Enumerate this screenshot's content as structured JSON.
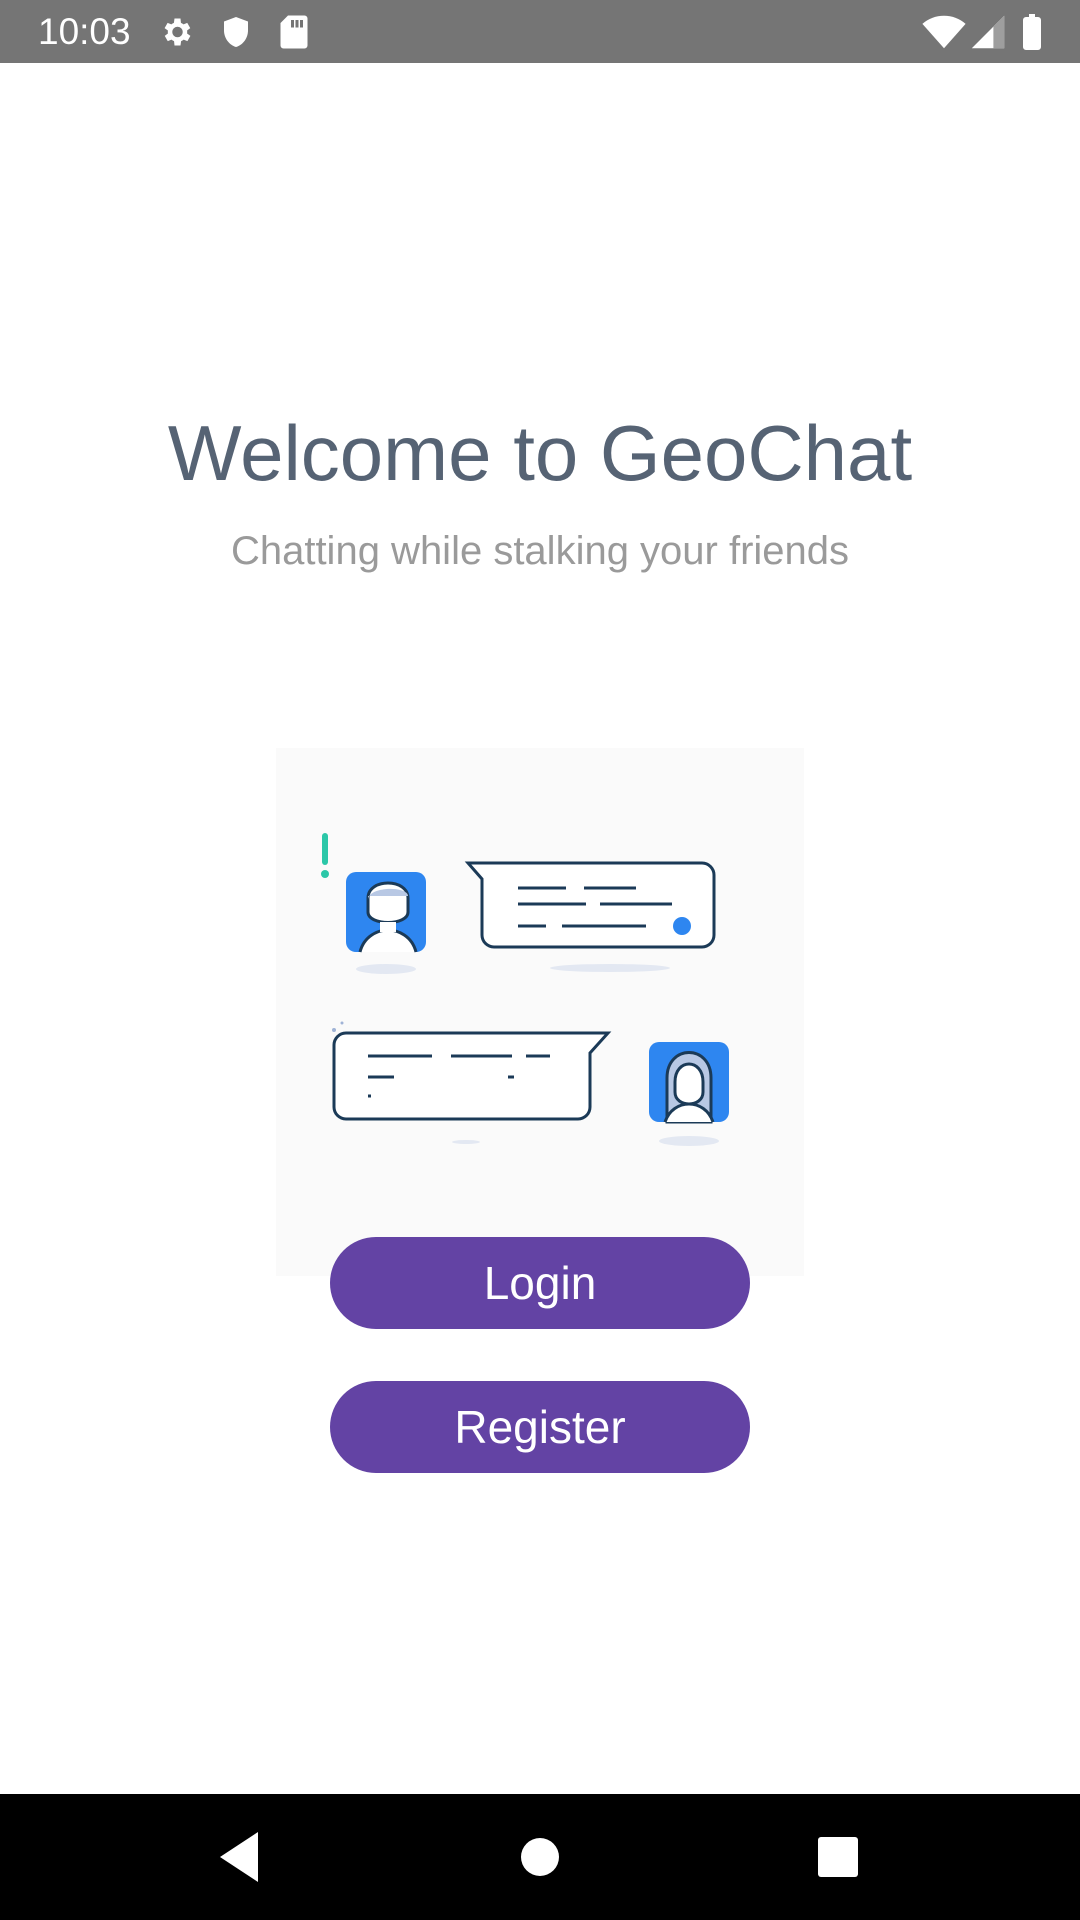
{
  "status_bar": {
    "time": "10:03",
    "icons_left": [
      "settings-icon",
      "shield-icon",
      "sd-card-icon"
    ],
    "icons_right": [
      "wifi-icon",
      "cellular-signal-icon",
      "battery-icon"
    ]
  },
  "welcome": {
    "title": "Welcome to GeoChat",
    "subtitle": "Chatting while stalking your friends"
  },
  "buttons": {
    "login_label": "Login",
    "register_label": "Register"
  },
  "nav_bar": {
    "items": [
      "back-icon",
      "home-icon",
      "recents-icon"
    ]
  },
  "colors": {
    "status_bar_bg": "#757575",
    "title": "#566374",
    "subtitle": "#9a9a9a",
    "button_bg": "#6343a4",
    "button_text": "#ffffff",
    "illustration_accent": "#2e86f0",
    "illustration_line": "#1b3a57",
    "illustration_exclaim": "#2bc7a8",
    "nav_bar_bg": "#000000"
  }
}
